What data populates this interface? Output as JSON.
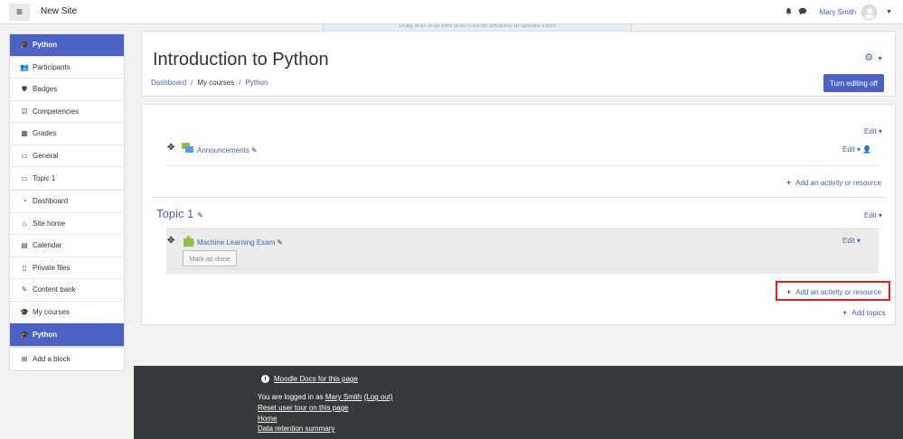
{
  "navbar": {
    "menu_icon": "hamburger-icon",
    "site_name": "New Site",
    "user_name": "Mary Smith"
  },
  "dropzone_text": "Drag and drop files onto course sections to upload them",
  "drawer": {
    "course_items": [
      {
        "label": "Python",
        "icon": "graduation-cap-icon",
        "active": true
      },
      {
        "label": "Participants",
        "icon": "users-icon"
      },
      {
        "label": "Badges",
        "icon": "shield-icon"
      },
      {
        "label": "Competencies",
        "icon": "checkbox-icon"
      },
      {
        "label": "Grades",
        "icon": "table-icon"
      },
      {
        "label": "General",
        "icon": "folder-icon"
      },
      {
        "label": "Topic 1",
        "icon": "folder-icon"
      }
    ],
    "site_items": [
      {
        "label": "Dashboard",
        "icon": "dashboard-icon"
      },
      {
        "label": "Site home",
        "icon": "home-icon"
      },
      {
        "label": "Calendar",
        "icon": "calendar-icon"
      },
      {
        "label": "Private files",
        "icon": "file-icon"
      },
      {
        "label": "Content bank",
        "icon": "brush-icon"
      },
      {
        "label": "My courses",
        "icon": "graduation-cap-icon"
      },
      {
        "label": "Python",
        "icon": "graduation-cap-icon",
        "active": true
      }
    ],
    "add_block": "Add a block"
  },
  "header": {
    "title": "Introduction to Python",
    "breadcrumb": [
      "Dashboard",
      "My courses",
      "Python"
    ],
    "edit_button": "Turn editing off"
  },
  "course": {
    "edit_label": "Edit",
    "section0": {
      "activity_name": "Announcements",
      "add_activity": "Add an activity or resource"
    },
    "section1": {
      "title": "Topic 1",
      "activity_name": "Machine Learning Exam",
      "mark_done": "Mark as done",
      "add_activity": "Add an activity or resource"
    },
    "add_topics": "Add topics"
  },
  "footer": {
    "docs_link": "Moodle Docs for this page",
    "logged_in_prefix": "You are logged in as",
    "logged_in_user": "Mary Smith",
    "logout": "(Log out)",
    "reset_tour": "Reset user tour on this page",
    "home": "Home",
    "data_retention": "Data retention summary"
  },
  "colors": {
    "primary": "#4c63c4",
    "link": "#4c5fb0",
    "footer_bg": "#373a3c",
    "highlight": "#e02020"
  }
}
